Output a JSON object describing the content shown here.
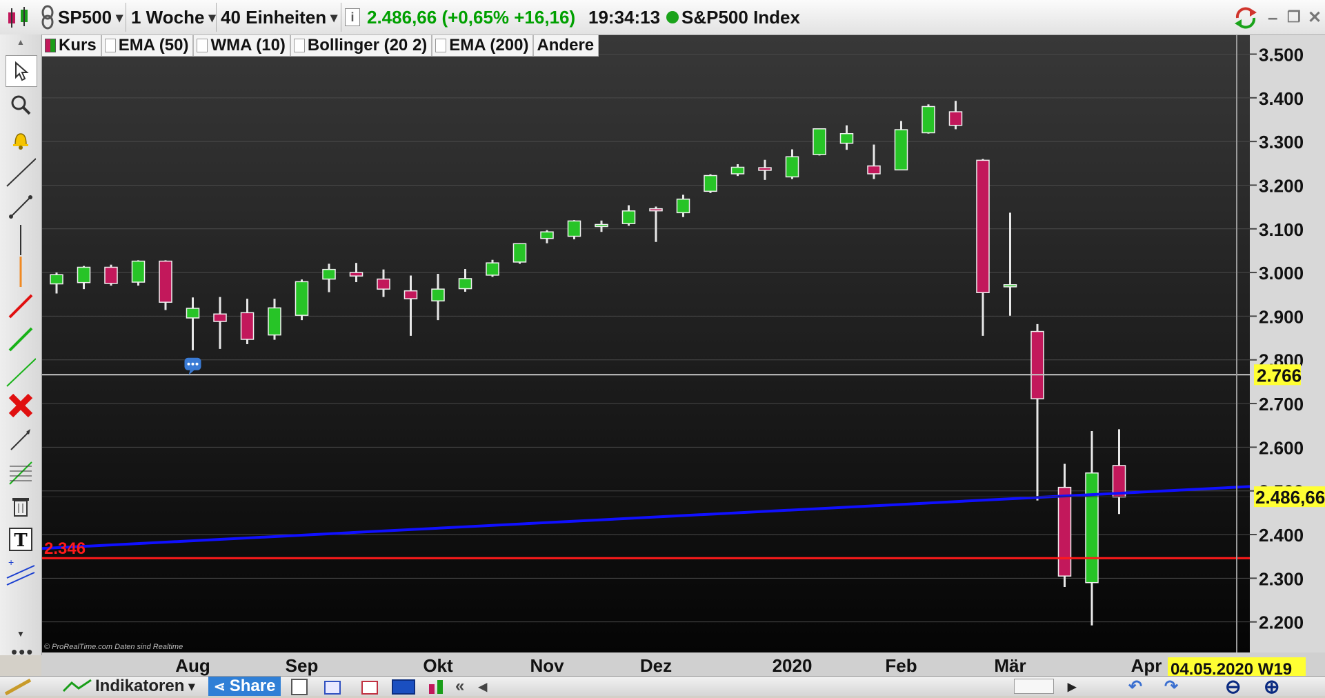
{
  "toolbar": {
    "symbol": "SP500",
    "interval": "1 Woche",
    "units": "40 Einheiten",
    "price": "2.486,66",
    "change": "(+0,65% +16,16)",
    "time": "19:34:13",
    "instrument": "S&P500 Index",
    "colors": {
      "price": "#00a000",
      "status_dot": "#1aa31a"
    }
  },
  "indicators": [
    {
      "label": "Kurs",
      "checked": true
    },
    {
      "label": "EMA (50)",
      "checked": false
    },
    {
      "label": "WMA (10)",
      "checked": false
    },
    {
      "label": "Bollinger (20 2)",
      "checked": false
    },
    {
      "label": "EMA (200)",
      "checked": false
    },
    {
      "label": "Andere",
      "checked": null
    }
  ],
  "tools": [
    "cursor-icon",
    "zoom-icon",
    "alert-bell-icon",
    "trendline-icon",
    "segment-icon",
    "vertical-line-icon",
    "red-line-icon",
    "green-line-icon",
    "green-ray-icon",
    "delete-icon",
    "arrow-line-icon",
    "fibonacci-icon",
    "trash-icon",
    "text-icon",
    "channel-icon",
    "more-icon"
  ],
  "bottom": {
    "indicators_label": "Indikatoren",
    "share_label": "Share"
  },
  "copyright": "© ProRealTime.com  Daten sind Realtime",
  "chart_data": {
    "type": "candlestick",
    "ylim": [
      2130,
      3545
    ],
    "y_ticks": [
      {
        "v": 3500,
        "label": "3.500"
      },
      {
        "v": 3400,
        "label": "3.400"
      },
      {
        "v": 3300,
        "label": "3.300"
      },
      {
        "v": 3200,
        "label": "3.200"
      },
      {
        "v": 3100,
        "label": "3.100"
      },
      {
        "v": 3000,
        "label": "3.000"
      },
      {
        "v": 2900,
        "label": "2.900"
      },
      {
        "v": 2800,
        "label": "2.800"
      },
      {
        "v": 2700,
        "label": "2.700"
      },
      {
        "v": 2600,
        "label": "2.600"
      },
      {
        "v": 2500,
        "label": "2.500"
      },
      {
        "v": 2400,
        "label": "2.400"
      },
      {
        "v": 2300,
        "label": "2.300"
      },
      {
        "v": 2200,
        "label": "2.200"
      }
    ],
    "x_labels": [
      {
        "i": 5,
        "label": "Aug"
      },
      {
        "i": 9,
        "label": "Sep"
      },
      {
        "i": 14,
        "label": "Okt"
      },
      {
        "i": 18,
        "label": "Nov"
      },
      {
        "i": 22,
        "label": "Dez"
      },
      {
        "i": 27,
        "label": "2020"
      },
      {
        "i": 31,
        "label": "Feb"
      },
      {
        "i": 35,
        "label": "Mär"
      },
      {
        "i": 40,
        "label": "Apr"
      }
    ],
    "candles": [
      {
        "o": 2974,
        "h": 3000,
        "l": 2952,
        "c": 2995
      },
      {
        "o": 2977,
        "h": 3015,
        "l": 2962,
        "c": 3012
      },
      {
        "o": 3012,
        "h": 3018,
        "l": 2970,
        "c": 2975
      },
      {
        "o": 2978,
        "h": 3028,
        "l": 2970,
        "c": 3026
      },
      {
        "o": 3026,
        "h": 3028,
        "l": 2914,
        "c": 2932
      },
      {
        "o": 2896,
        "h": 2943,
        "l": 2822,
        "c": 2918
      },
      {
        "o": 2905,
        "h": 2944,
        "l": 2825,
        "c": 2888
      },
      {
        "o": 2908,
        "h": 2940,
        "l": 2836,
        "c": 2847
      },
      {
        "o": 2857,
        "h": 2940,
        "l": 2846,
        "c": 2919
      },
      {
        "o": 2902,
        "h": 2984,
        "l": 2891,
        "c": 2979
      },
      {
        "o": 2985,
        "h": 3020,
        "l": 2955,
        "c": 3007
      },
      {
        "o": 3000,
        "h": 3022,
        "l": 2978,
        "c": 2992
      },
      {
        "o": 2985,
        "h": 3007,
        "l": 2944,
        "c": 2962
      },
      {
        "o": 2958,
        "h": 2993,
        "l": 2855,
        "c": 2940
      },
      {
        "o": 2935,
        "h": 2997,
        "l": 2891,
        "c": 2962
      },
      {
        "o": 2963,
        "h": 3008,
        "l": 2956,
        "c": 2986
      },
      {
        "o": 2994,
        "h": 3029,
        "l": 2990,
        "c": 3022
      },
      {
        "o": 3024,
        "h": 3067,
        "l": 3020,
        "c": 3066
      },
      {
        "o": 3078,
        "h": 3097,
        "l": 3067,
        "c": 3093
      },
      {
        "o": 3083,
        "h": 3120,
        "l": 3076,
        "c": 3118
      },
      {
        "o": 3107,
        "h": 3119,
        "l": 3093,
        "c": 3110
      },
      {
        "o": 3112,
        "h": 3154,
        "l": 3107,
        "c": 3141
      },
      {
        "o": 3146,
        "h": 3151,
        "l": 3070,
        "c": 3145
      },
      {
        "o": 3137,
        "h": 3178,
        "l": 3127,
        "c": 3168
      },
      {
        "o": 3186,
        "h": 3225,
        "l": 3182,
        "c": 3222
      },
      {
        "o": 3226,
        "h": 3248,
        "l": 3221,
        "c": 3241
      },
      {
        "o": 3240,
        "h": 3258,
        "l": 3212,
        "c": 3234
      },
      {
        "o": 3219,
        "h": 3282,
        "l": 3214,
        "c": 3265
      },
      {
        "o": 3270,
        "h": 3329,
        "l": 3268,
        "c": 3329
      },
      {
        "o": 3296,
        "h": 3337,
        "l": 3281,
        "c": 3318
      },
      {
        "o": 3244,
        "h": 3293,
        "l": 3214,
        "c": 3226
      },
      {
        "o": 3235,
        "h": 3347,
        "l": 3234,
        "c": 3327
      },
      {
        "o": 3320,
        "h": 3385,
        "l": 3318,
        "c": 3380
      },
      {
        "o": 3368,
        "h": 3393,
        "l": 3328,
        "c": 3337
      },
      {
        "o": 3257,
        "h": 3260,
        "l": 2855,
        "c": 2954
      },
      {
        "o": 2970,
        "h": 3137,
        "l": 2901,
        "c": 2972
      },
      {
        "o": 2865,
        "h": 2882,
        "l": 2478,
        "c": 2711
      },
      {
        "o": 2508,
        "h": 2562,
        "l": 2280,
        "c": 2305
      },
      {
        "o": 2290,
        "h": 2637,
        "l": 2192,
        "c": 2541
      },
      {
        "o": 2558,
        "h": 2641,
        "l": 2447,
        "c": 2486
      }
    ],
    "horizontal_lines": [
      {
        "value": 2766,
        "label": "2.766",
        "color": "#c8c8c8"
      },
      {
        "value": 2346,
        "label": "2.346",
        "color": "#ff1a1a"
      }
    ],
    "trendline": {
      "from_i": 0,
      "from_v": 2368,
      "to_i": 44,
      "to_v": 2510,
      "color": "#1010ff"
    },
    "last_price": {
      "value": 2486.66,
      "label": "2,486,66",
      "display": "2.486,66"
    },
    "cursor_date": "04.05.2020 W19"
  }
}
